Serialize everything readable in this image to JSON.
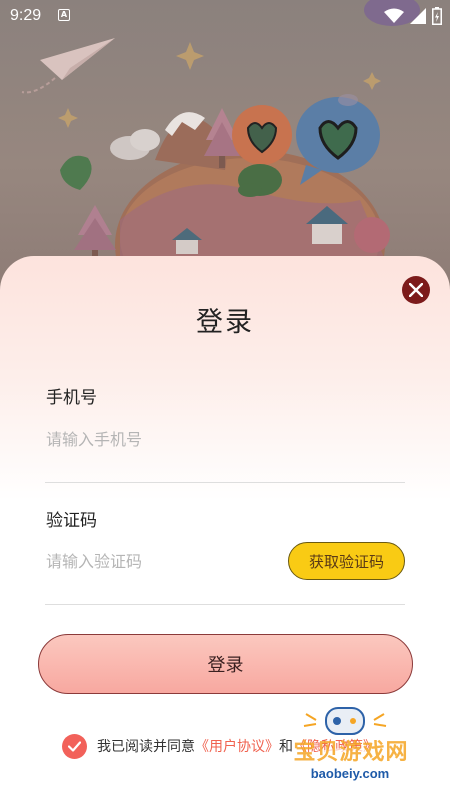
{
  "status_bar": {
    "time": "9:29",
    "notification_icon": "a-icon",
    "icons": [
      "wifi-icon",
      "signal-icon",
      "battery-charging-icon"
    ]
  },
  "hero": {
    "description_icons": [
      "paper-plane-icon",
      "heart-bubble-icon",
      "tree-icon",
      "house-icon",
      "planet-icon"
    ]
  },
  "login": {
    "title": "登录",
    "close_icon": "close-icon",
    "phone": {
      "label": "手机号",
      "placeholder": "请输入手机号",
      "value": ""
    },
    "code": {
      "label": "验证码",
      "placeholder": "请输入验证码",
      "value": "",
      "button_label": "获取验证码"
    },
    "submit_label": "登录",
    "agreement": {
      "checked": true,
      "prefix": "我已阅读并同意",
      "user_agreement": "《用户协议》",
      "conjunction": "和",
      "privacy_policy": "《隐私政策》"
    }
  },
  "watermark": {
    "title": "宝贝游戏网",
    "url": "baobeiy.com"
  },
  "colors": {
    "accent": "#f2615a",
    "button_yellow": "#f9cb14",
    "close_dark_red": "#7c1b1b",
    "login_pink": "#f8a8a0",
    "link_red": "#f0624f"
  }
}
